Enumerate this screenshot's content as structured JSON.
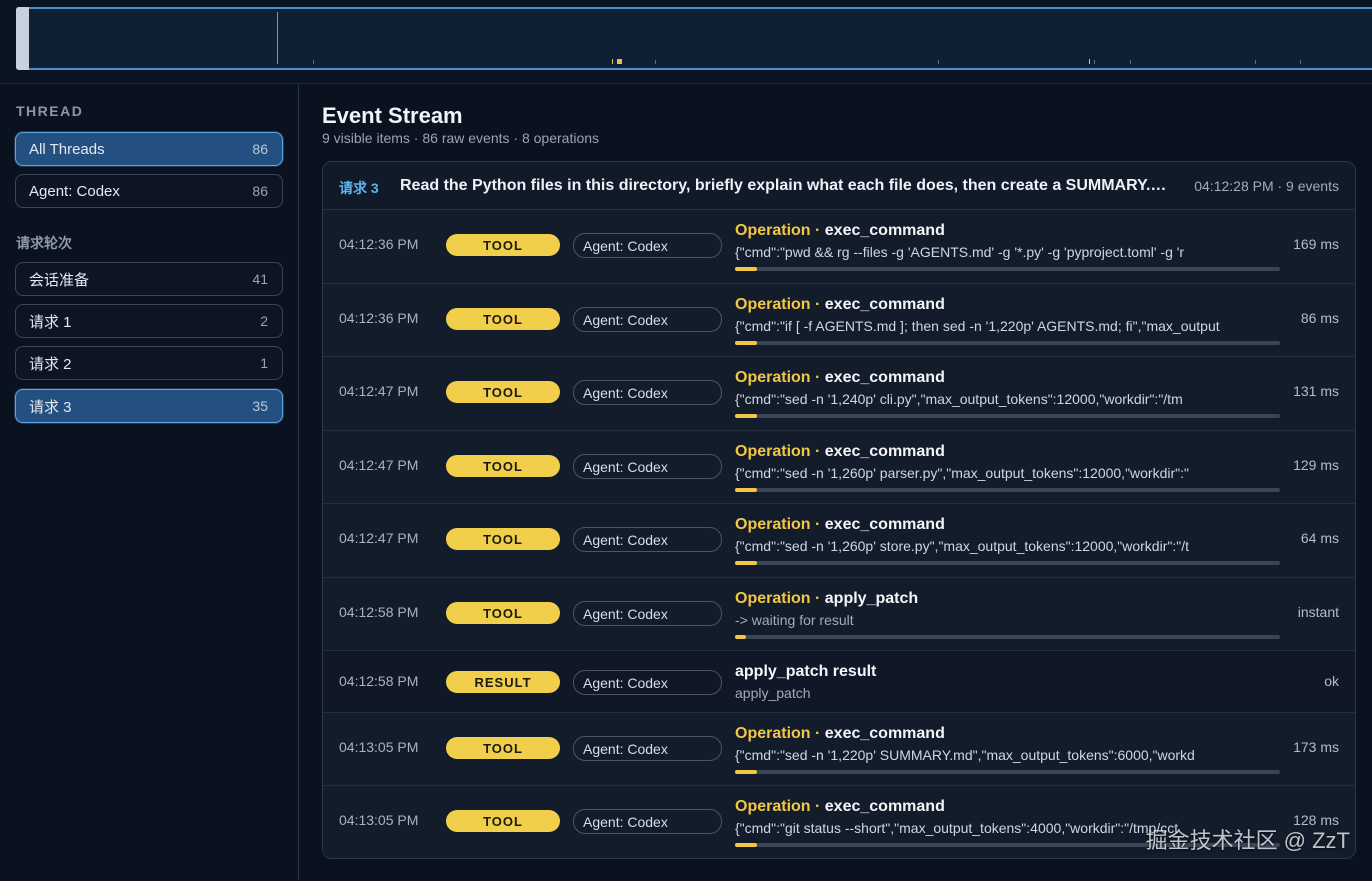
{
  "sidebar": {
    "thread_heading": "THREAD",
    "threads": [
      {
        "label": "All Threads",
        "count": "86",
        "active": true
      },
      {
        "label": "Agent: Codex",
        "count": "86",
        "active": false
      }
    ],
    "rounds_heading": "请求轮次",
    "rounds": [
      {
        "label": "会话准备",
        "count": "41",
        "active": false
      },
      {
        "label": "请求 1",
        "count": "2",
        "active": false
      },
      {
        "label": "请求 2",
        "count": "1",
        "active": false
      },
      {
        "label": "请求 3",
        "count": "35",
        "active": true
      }
    ]
  },
  "main": {
    "title": "Event Stream",
    "subtitle": "9 visible items · 86 raw events · 8 operations",
    "request": {
      "tag": "请求 3",
      "title": "Read the Python files in this directory, briefly explain what each file does, then create a SUMMARY.md",
      "meta": "04:12:28 PM · 9 events"
    },
    "events": [
      {
        "time": "04:12:36 PM",
        "badge": "TOOL",
        "agent": "Agent: Codex",
        "kind": "Operation",
        "name": "exec_command",
        "args": "{\"cmd\":\"pwd && rg --files -g 'AGENTS.md' -g '*.py' -g 'pyproject.toml' -g 'r",
        "duration": "169 ms",
        "progress": 0.04
      },
      {
        "time": "04:12:36 PM",
        "badge": "TOOL",
        "agent": "Agent: Codex",
        "kind": "Operation",
        "name": "exec_command",
        "args": "{\"cmd\":\"if [ -f AGENTS.md ]; then sed -n '1,220p' AGENTS.md; fi\",\"max_output",
        "duration": "86 ms",
        "progress": 0.04
      },
      {
        "time": "04:12:47 PM",
        "badge": "TOOL",
        "agent": "Agent: Codex",
        "kind": "Operation",
        "name": "exec_command",
        "args": "{\"cmd\":\"sed -n '1,240p' cli.py\",\"max_output_tokens\":12000,\"workdir\":\"/tm",
        "duration": "131 ms",
        "progress": 0.04
      },
      {
        "time": "04:12:47 PM",
        "badge": "TOOL",
        "agent": "Agent: Codex",
        "kind": "Operation",
        "name": "exec_command",
        "args": "{\"cmd\":\"sed -n '1,260p' parser.py\",\"max_output_tokens\":12000,\"workdir\":\"",
        "duration": "129 ms",
        "progress": 0.04
      },
      {
        "time": "04:12:47 PM",
        "badge": "TOOL",
        "agent": "Agent: Codex",
        "kind": "Operation",
        "name": "exec_command",
        "args": "{\"cmd\":\"sed -n '1,260p' store.py\",\"max_output_tokens\":12000,\"workdir\":\"/t",
        "duration": "64 ms",
        "progress": 0.04
      },
      {
        "time": "04:12:58 PM",
        "badge": "TOOL",
        "agent": "Agent: Codex",
        "kind": "Operation",
        "name": "apply_patch",
        "args": "-> waiting for result",
        "duration": "instant",
        "progress": 0.02
      },
      {
        "time": "04:12:58 PM",
        "badge": "RESULT",
        "agent": "Agent: Codex",
        "kind": "",
        "name": "apply_patch result",
        "args": "apply_patch",
        "duration": "ok",
        "progress": null
      },
      {
        "time": "04:13:05 PM",
        "badge": "TOOL",
        "agent": "Agent: Codex",
        "kind": "Operation",
        "name": "exec_command",
        "args": "{\"cmd\":\"sed -n '1,220p' SUMMARY.md\",\"max_output_tokens\":6000,\"workd",
        "duration": "173 ms",
        "progress": 0.04
      },
      {
        "time": "04:13:05 PM",
        "badge": "TOOL",
        "agent": "Agent: Codex",
        "kind": "Operation",
        "name": "exec_command",
        "args": "{\"cmd\":\"git status --short\",\"max_output_tokens\":4000,\"workdir\":\"/tmp/cct",
        "duration": "128 ms",
        "progress": 0.04
      }
    ]
  },
  "watermark": "掘金技术社区 @ ZzT",
  "colors": {
    "accent": "#5fa7e6",
    "tool": "#f2cf4a",
    "background": "#0a1220"
  }
}
